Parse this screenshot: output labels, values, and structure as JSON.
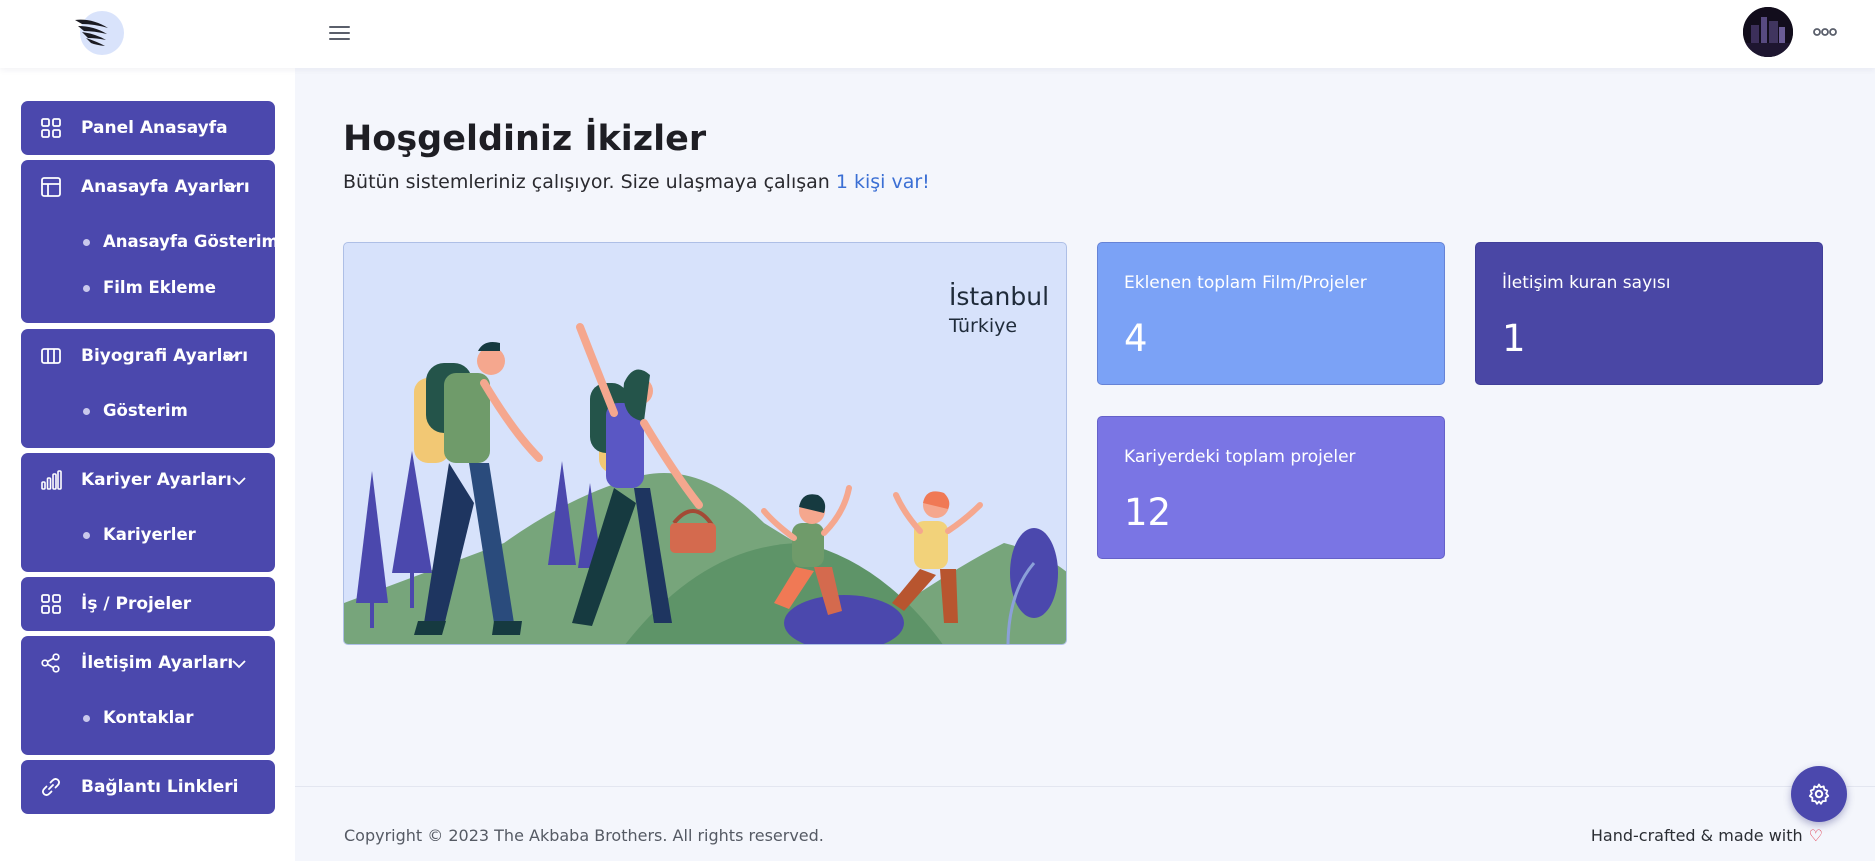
{
  "topbar": {
    "avatar": "user-avatar"
  },
  "sidebar": {
    "items": [
      {
        "label": "Panel Anasayfa",
        "icon": "grid-icon",
        "submenu": []
      },
      {
        "label": "Anasayfa Ayarları",
        "icon": "layout-icon",
        "submenu": [
          "Anasayfa Gösterimi",
          "Film Ekleme"
        ]
      },
      {
        "label": "Biyografi Ayarları",
        "icon": "columns-icon",
        "submenu": [
          "Gösterim"
        ]
      },
      {
        "label": "Kariyer Ayarları",
        "icon": "bar-chart-icon",
        "submenu": [
          "Kariyerler"
        ]
      },
      {
        "label": "İş / Projeler",
        "icon": "grid-icon",
        "submenu": []
      },
      {
        "label": "İletişim Ayarları",
        "icon": "share-icon",
        "submenu": [
          "Kontaklar"
        ]
      },
      {
        "label": "Bağlantı Linkleri",
        "icon": "link-icon",
        "submenu": []
      }
    ]
  },
  "main": {
    "title": "Hoşgeldiniz İkizler",
    "subtitle": "Bütün sistemleriniz çalışıyor. Size ulaşmaya çalışan ",
    "subtitle_link": "1 kişi var!",
    "hero": {
      "city": "İstanbul",
      "country": "Türkiye"
    },
    "stats": [
      {
        "label": "Eklenen toplam Film/Projeler",
        "value": "4",
        "color": "#7ba2f6"
      },
      {
        "label": "İletişim kuran sayısı",
        "value": "1",
        "color": "#4a47a5"
      },
      {
        "label": "Kariyerdeki toplam projeler",
        "value": "12",
        "color": "#7a75e4"
      }
    ]
  },
  "footer": {
    "copyright": "Copyright © 2023 The Akbaba Brothers. All rights reserved.",
    "handcrafted": "Hand-crafted & made with"
  },
  "colors": {
    "sidebar_bg": "#4b48ad",
    "link": "#3b6fd4",
    "heart": "#e0354a"
  }
}
